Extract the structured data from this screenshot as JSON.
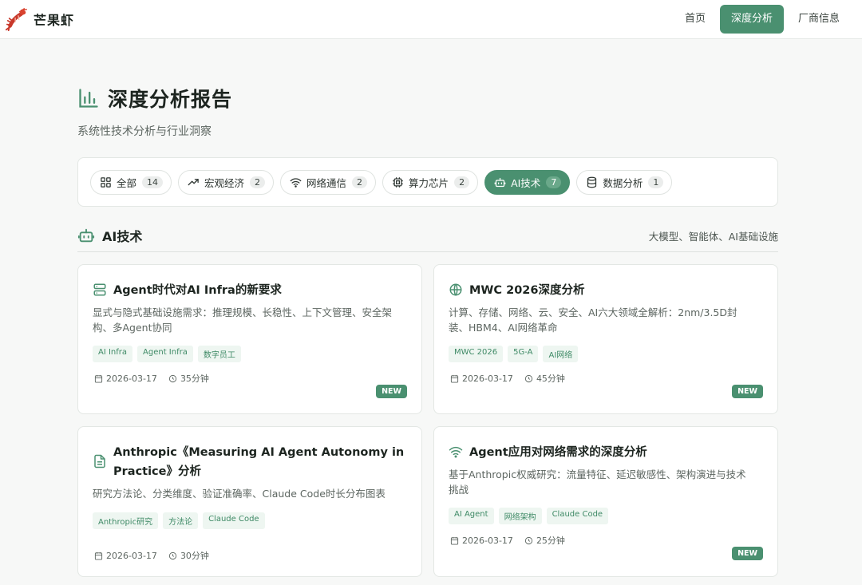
{
  "brand": {
    "name": "芒果虾"
  },
  "nav": [
    {
      "label": "首页"
    },
    {
      "label": "深度分析"
    },
    {
      "label": "厂商信息"
    }
  ],
  "page": {
    "title": "深度分析报告",
    "subtitle": "系统性技术分析与行业洞察"
  },
  "filters": [
    {
      "label": "全部",
      "count": "14",
      "icon": "grid-icon"
    },
    {
      "label": "宏观经济",
      "count": "2",
      "icon": "trending-up-icon"
    },
    {
      "label": "网络通信",
      "count": "2",
      "icon": "wifi-icon"
    },
    {
      "label": "算力芯片",
      "count": "2",
      "icon": "chip-icon"
    },
    {
      "label": "AI技术",
      "count": "7",
      "icon": "robot-icon"
    },
    {
      "label": "数据分析",
      "count": "1",
      "icon": "database-icon"
    }
  ],
  "section": {
    "title": "AI技术",
    "description": "大模型、智能体、AI基础设施"
  },
  "cards": [
    {
      "title": "Agent时代对AI Infra的新要求",
      "description": "显式与隐式基础设施需求：推理规模、长稳性、上下文管理、安全架构、多Agent协同",
      "tags": [
        "AI Infra",
        "Agent Infra",
        "数字员工"
      ],
      "date": "2026-03-17",
      "duration": "35分钟",
      "badge": "NEW",
      "icon": "server-icon"
    },
    {
      "title": "MWC 2026深度分析",
      "description": "计算、存储、网络、云、安全、AI六大领域全解析：2nm/3.5D封装、HBM4、AI网络革命",
      "tags": [
        "MWC 2026",
        "5G-A",
        "AI网络"
      ],
      "date": "2026-03-17",
      "duration": "45分钟",
      "badge": "NEW",
      "icon": "globe-icon"
    },
    {
      "title": "Anthropic《Measuring AI Agent Autonomy in Practice》分析",
      "description": "研究方法论、分类维度、验证准确率、Claude Code时长分布图表",
      "tags": [
        "Anthropic研究",
        "方法论",
        "Claude Code"
      ],
      "date": "2026-03-17",
      "duration": "30分钟",
      "icon": "document-icon"
    },
    {
      "title": "Agent应用对网络需求的深度分析",
      "description": "基于Anthropic权威研究：流量特征、延迟敏感性、架构演进与技术挑战",
      "tags": [
        "AI Agent",
        "网络架构",
        "Claude Code"
      ],
      "date": "2026-03-17",
      "duration": "25分钟",
      "badge": "NEW",
      "icon": "wifi-icon"
    }
  ],
  "colors": {
    "accent": "#4a9070",
    "tag_bg": "#eef6f1",
    "tag_text": "#3f8a66"
  }
}
